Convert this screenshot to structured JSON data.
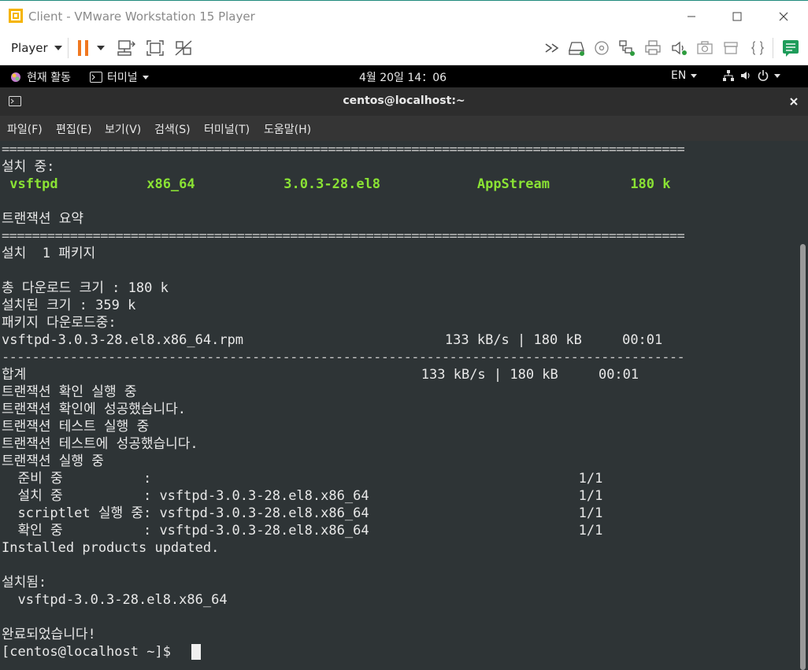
{
  "vmware": {
    "title": "Client - VMware Workstation 15 Player",
    "player_label": "Player"
  },
  "gnome": {
    "activities": "현재 활동",
    "app_menu": "터미널",
    "clock": "4월 20일  14：06",
    "language": "EN"
  },
  "terminal": {
    "title": "centos@localhost:~",
    "menu": [
      "파일(F)",
      "편집(E)",
      "보기(V)",
      "검색(S)",
      "터미널(T)",
      "도움말(H)"
    ],
    "separator_double": "==========================================================================================",
    "separator_single": "------------------------------------------------------------------------------------------",
    "lines": {
      "installing_header": "설치 중:",
      "package_row": " vsftpd           x86_64           3.0.3-28.el8            AppStream          180 k",
      "summary_header": "트랜잭션 요약",
      "install_count": "설치  1 패키지",
      "total_download": "총 다운로드 크기 : 180 k",
      "installed_size": "설치된 크기 : 359 k",
      "downloading": "패키지 다운로드중:",
      "rpm_download": "vsftpd-3.0.3-28.el8.x86_64.rpm                         133 kB/s | 180 kB     00:01",
      "total": "합계                                                 133 kB/s | 180 kB     00:01",
      "check_running": "트랜잭션 확인 실행 중",
      "check_success": "트랜잭션 확인에 성공했습니다.",
      "test_running": "트랜잭션 테스트 실행 중",
      "test_success": "트랜잭션 테스트에 성공했습니다.",
      "tx_running": "트랜잭션 실행 중",
      "step_prepare": "  준비 중          :                                                     1/1",
      "step_install": "  설치 중          : vsftpd-3.0.3-28.el8.x86_64                          1/1",
      "step_scriptlet": "  scriptlet 실행 중: vsftpd-3.0.3-28.el8.x86_64                          1/1",
      "step_verify": "  확인 중          : vsftpd-3.0.3-28.el8.x86_64                          1/1",
      "products_updated": "Installed products updated.",
      "installed_header": "설치됨:",
      "installed_pkg": "  vsftpd-3.0.3-28.el8.x86_64",
      "complete": "완료되었습니다!",
      "prompt": "[centos@localhost ~]$ "
    }
  },
  "colors": {
    "terminal_bg": "#2e3436",
    "terminal_fg": "#e8e8e8",
    "package_highlight": "#8ae234",
    "pause_orange": "#f07820",
    "accent_green": "#2e9c3e"
  }
}
